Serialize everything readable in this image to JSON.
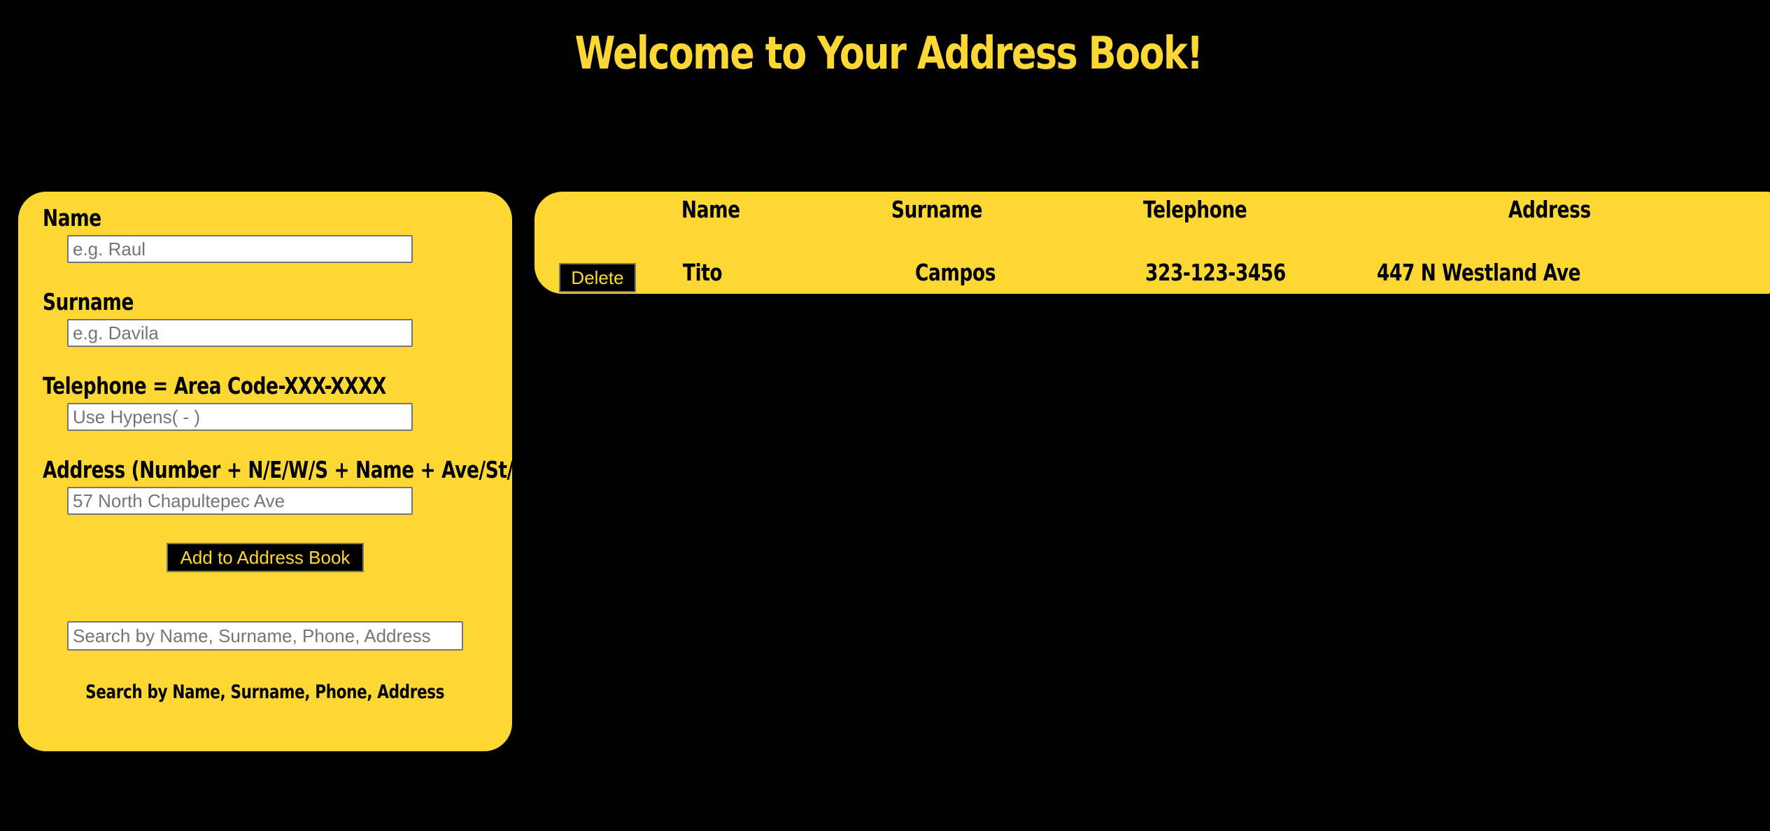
{
  "header": {
    "title": "Welcome to Your Address Book!"
  },
  "form": {
    "name_label": "Name",
    "name_placeholder": "e.g. Raul",
    "surname_label": "Surname",
    "surname_placeholder": "e.g. Davila",
    "telephone_label": "Telephone = Area Code-XXX-XXXX",
    "telephone_placeholder": "Use Hypens( - )",
    "address_label": "Address (Number + N/E/W/S + Name + Ave/St/Blvd)",
    "address_placeholder": "57 North Chapultepec Ave",
    "add_button_label": "Add to Address Book",
    "search_placeholder": "Search by Name, Surname, Phone, Address",
    "search_caption": "Search by Name, Surname, Phone, Address"
  },
  "table": {
    "columns": [
      "Name",
      "Surname",
      "Telephone",
      "Address"
    ],
    "rows": [
      {
        "delete_label": "Delete",
        "name": "Tito",
        "surname": "Campos",
        "telephone": "323-123-3456",
        "address": "447 N Westland Ave"
      }
    ]
  },
  "colors": {
    "background": "#000000",
    "accent": "#fdd835"
  }
}
